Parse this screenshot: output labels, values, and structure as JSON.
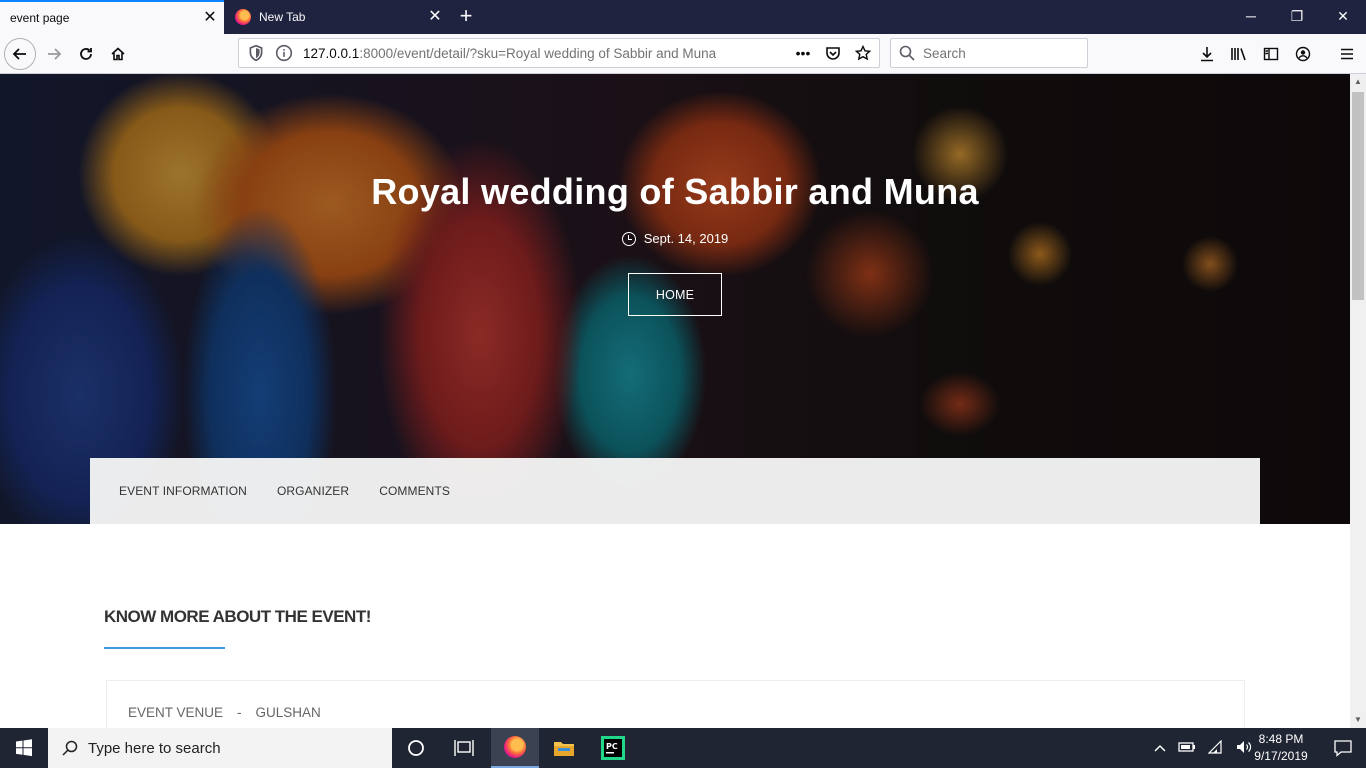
{
  "browser": {
    "tabs": [
      {
        "title": "event page",
        "active": true
      },
      {
        "title": "New Tab",
        "active": false
      }
    ],
    "url_host": "127.0.0.1",
    "url_path": ":8000/event/detail/?sku=Royal wedding of Sabbir and Muna",
    "search_placeholder": "Search"
  },
  "hero": {
    "title": "Royal wedding of Sabbir and Muna",
    "date": "Sept. 14, 2019",
    "home_button": "HOME"
  },
  "event_tabs": [
    "EVENT INFORMATION",
    "ORGANIZER",
    "COMMENTS"
  ],
  "section": {
    "title": "KNOW MORE ABOUT THE EVENT!",
    "accent_color": "#3a9bd9",
    "venue_label": "EVENT VENUE",
    "venue_separator": "-",
    "venue_value": "GULSHAN"
  },
  "taskbar": {
    "search_placeholder": "Type here to search",
    "time": "8:48 PM",
    "date": "9/17/2019"
  }
}
